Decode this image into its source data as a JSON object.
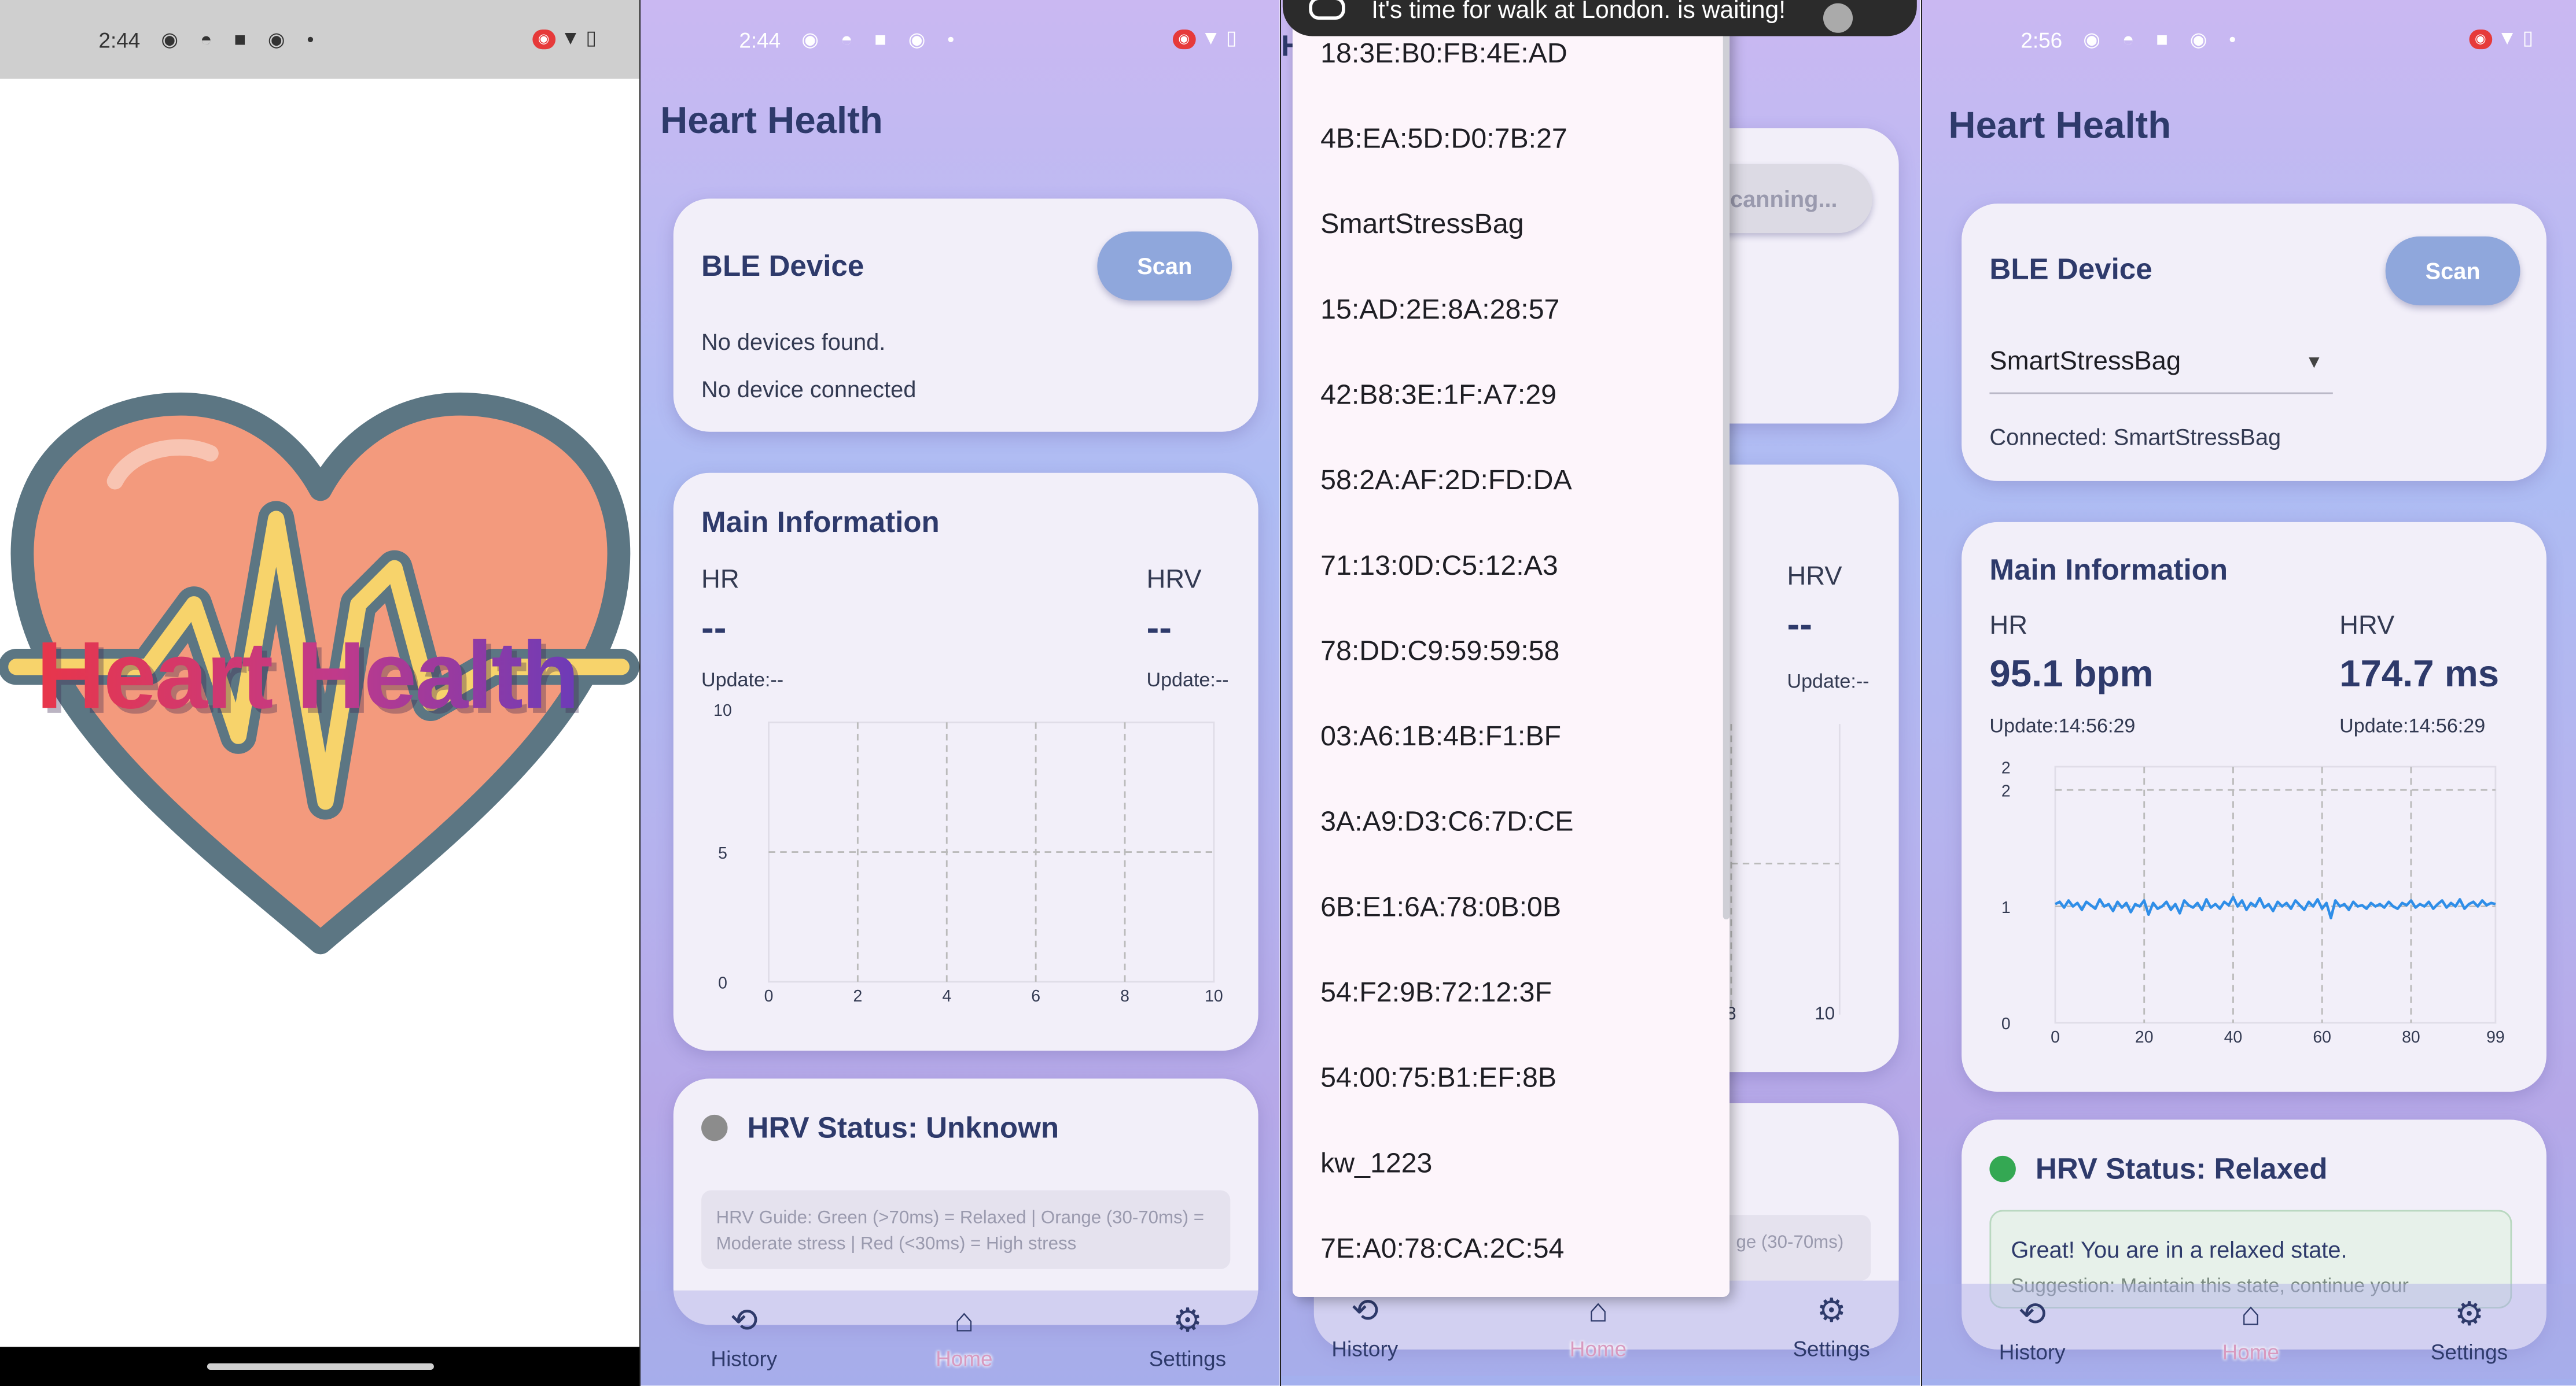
{
  "screens": {
    "splash": {
      "status": {
        "time": "2:44"
      },
      "logo_text": "Heart Health"
    },
    "home_empty": {
      "status": {
        "time": "2:44"
      },
      "app_title": "Heart Health",
      "ble_card": {
        "title": "BLE Device",
        "scan_label": "Scan",
        "devices_text": "No devices found.",
        "connection_text": "No device connected"
      },
      "main_card": {
        "title": "Main Information",
        "hr_label": "HR",
        "hrv_label": "HRV",
        "hr_value": "--",
        "hrv_value": "--",
        "hr_update": "Update:--",
        "hrv_update": "Update:--"
      },
      "chart_data": {
        "type": "line",
        "x": [],
        "y": [],
        "xlim": [
          0,
          10
        ],
        "ylim": [
          0,
          10
        ],
        "xticks": [
          "0",
          "2",
          "4",
          "6",
          "8",
          "10"
        ],
        "yticks": [
          "10",
          "5",
          "0"
        ],
        "grid": true
      },
      "hrv_card": {
        "title": "HRV Status: Unknown",
        "status_color": "#8c8c8c",
        "guide": "HRV Guide: Green (>70ms) = Relaxed | Orange (30-70ms) = Moderate stress | Red (<30ms) = High stress"
      }
    },
    "scan_list": {
      "notification": "It's time for walk at London.  is waiting!",
      "background_scan_label": "canning...",
      "background_hrv_label": "HRV",
      "background_hrv_value": "--",
      "background_update": "Update:--",
      "background_ticks": [
        "8",
        "10"
      ],
      "background_guide_fragment": "ge (30-70ms)",
      "background_title_fragment": "H",
      "devices": [
        "18:3E:B0:FB:4E:AD",
        "4B:EA:5D:D0:7B:27",
        "SmartStressBag",
        "15:AD:2E:8A:28:57",
        "42:B8:3E:1F:A7:29",
        "58:2A:AF:2D:FD:DA",
        "71:13:0D:C5:12:A3",
        "78:DD:C9:59:59:58",
        "03:A6:1B:4B:F1:BF",
        "3A:A9:D3:C6:7D:CE",
        "6B:E1:6A:78:0B:0B",
        "54:F2:9B:72:12:3F",
        "54:00:75:B1:EF:8B",
        "kw_1223",
        "7E:A0:78:CA:2C:54"
      ]
    },
    "home_connected": {
      "status": {
        "time": "2:56"
      },
      "app_title": "Heart Health",
      "ble_card": {
        "title": "BLE Device",
        "scan_label": "Scan",
        "selected_device": "SmartStressBag",
        "connection_text": "Connected: SmartStressBag"
      },
      "main_card": {
        "title": "Main Information",
        "hr_label": "HR",
        "hrv_label": "HRV",
        "hr_value": "95.1 bpm",
        "hrv_value": "174.7 ms",
        "hr_update": "Update:14:56:29",
        "hrv_update": "Update:14:56:29"
      },
      "chart_data": {
        "type": "line",
        "xlim": [
          0,
          99
        ],
        "ylim": [
          0,
          2.2
        ],
        "xticks": [
          "0",
          "20",
          "40",
          "60",
          "80",
          "99"
        ],
        "yticks": [
          "2",
          "2",
          "1",
          "0"
        ],
        "grid": true,
        "color": "#2f8ee8",
        "y": [
          1.02,
          1.04,
          0.99,
          1.05,
          1.0,
          1.03,
          0.97,
          1.04,
          1.01,
          0.98,
          1.06,
          1.0,
          1.02,
          0.96,
          1.04,
          0.99,
          1.03,
          0.95,
          1.02,
          1.0,
          1.05,
          0.93,
          1.03,
          0.98,
          1.0,
          1.04,
          0.97,
          1.02,
          0.94,
          1.05,
          1.01,
          0.99,
          1.03,
          0.97,
          1.06,
          0.99,
          1.02,
          0.98,
          1.04,
          1.01,
          1.08,
          1.0,
          1.05,
          0.97,
          1.03,
          1.0,
          1.07,
          0.99,
          1.02,
          0.96,
          1.04,
          1.0,
          1.03,
          0.98,
          1.05,
          1.01,
          0.97,
          1.04,
          1.0,
          1.06,
          0.98,
          1.03,
          0.9,
          1.05,
          1.0,
          1.02,
          0.97,
          1.04,
          1.0,
          1.01,
          0.98,
          1.03,
          1.0,
          1.02,
          0.99,
          1.04,
          1.0,
          0.98,
          1.03,
          1.01,
          1.05,
          0.99,
          1.02,
          1.0,
          1.04,
          0.98,
          1.02,
          1.05,
          0.99,
          1.03,
          1.0,
          1.06,
          0.98,
          1.02,
          1.04,
          1.0,
          1.05,
          1.01,
          1.03,
          1.02
        ]
      },
      "hrv_card": {
        "title": "HRV Status: Relaxed",
        "status_color": "#34a853",
        "message": "Great! You are in a relaxed state.",
        "suggestion": "Suggestion: Maintain this state, continue your"
      }
    }
  },
  "nav": {
    "history": "History",
    "home": "Home",
    "settings": "Settings"
  }
}
